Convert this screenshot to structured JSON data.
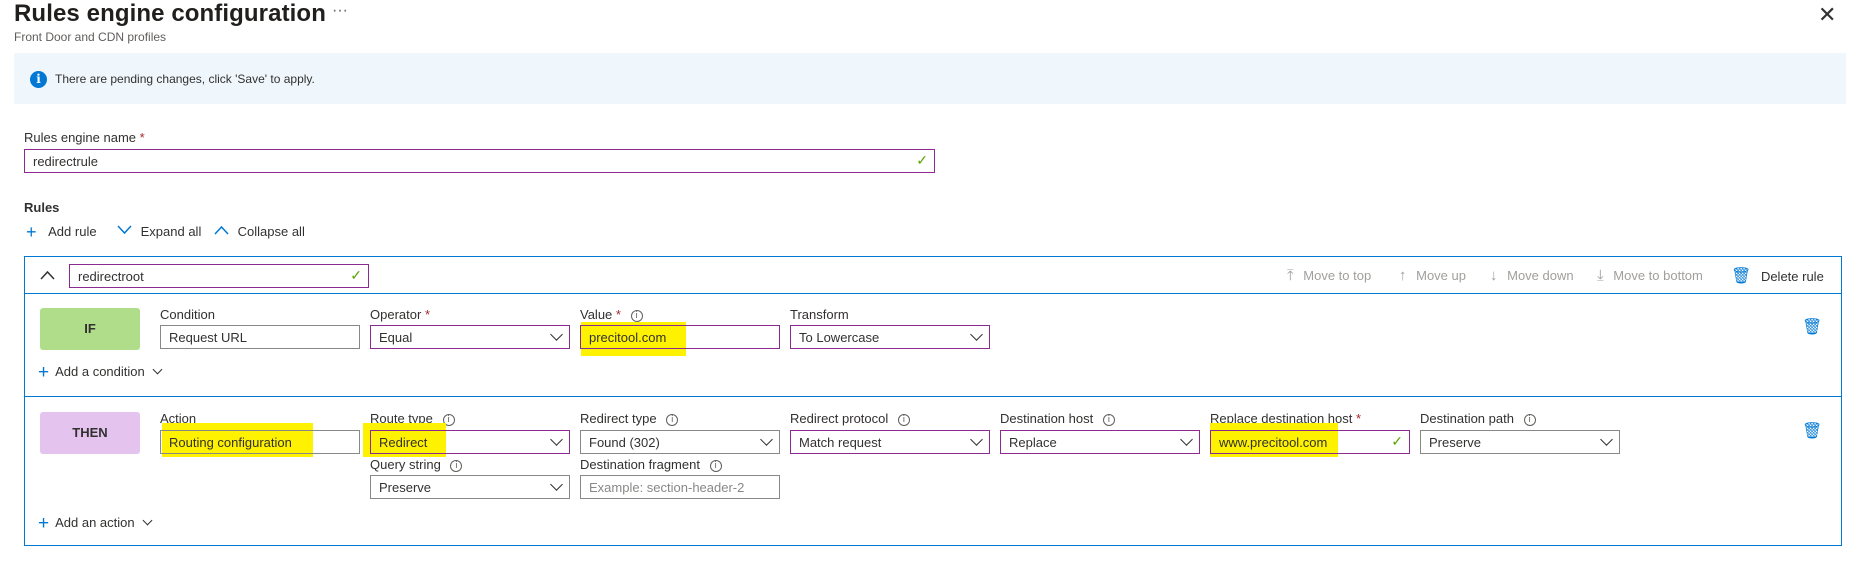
{
  "header": {
    "title": "Rules engine configuration",
    "more_label": "···",
    "subtitle": "Front Door and CDN profiles",
    "close_label": "✕"
  },
  "banner": {
    "icon": "info-icon",
    "text": "There are pending changes, click 'Save' to apply."
  },
  "engine": {
    "name_label": "Rules engine name",
    "required_mark": "*",
    "name_value": "redirectrule"
  },
  "rules_section": {
    "title": "Rules",
    "add_rule": "Add rule",
    "expand_all": "Expand all",
    "collapse_all": "Collapse all"
  },
  "rule": {
    "name": "redirectroot",
    "move_to_top": "Move to top",
    "move_up": "Move up",
    "move_down": "Move down",
    "move_to_bottom": "Move to bottom",
    "delete_rule": "Delete rule",
    "if_label": "IF",
    "condition": {
      "condition_label": "Condition",
      "condition_value": "Request URL",
      "operator_label": "Operator",
      "operator_value": "Equal",
      "value_label": "Value",
      "value_value": "precitool.com",
      "transform_label": "Transform",
      "transform_value": "To Lowercase"
    },
    "add_condition": "Add a condition",
    "then_label": "THEN",
    "action": {
      "action_label": "Action",
      "action_value": "Routing configuration",
      "route_type_label": "Route type",
      "route_type_value": "Redirect",
      "redirect_type_label": "Redirect type",
      "redirect_type_value": "Found (302)",
      "redirect_protocol_label": "Redirect protocol",
      "redirect_protocol_value": "Match request",
      "destination_host_label": "Destination host",
      "destination_host_value": "Replace",
      "replace_host_label": "Replace destination host",
      "replace_host_value": "www.precitool.com",
      "destination_path_label": "Destination path",
      "destination_path_value": "Preserve",
      "query_string_label": "Query string",
      "query_string_value": "Preserve",
      "fragment_label": "Destination fragment",
      "fragment_placeholder": "Example: section-header-2"
    },
    "add_action": "Add an action"
  },
  "colors": {
    "accent": "#0078d4",
    "if_pill": "#b0dd8a",
    "then_pill": "#e4c3ef",
    "highlight": "#fff200",
    "field_border_active": "#8c2a92",
    "banner_bg": "#eff6fc"
  }
}
